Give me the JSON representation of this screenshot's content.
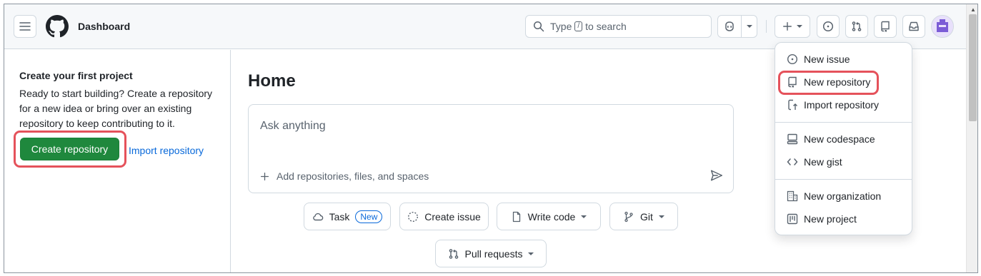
{
  "header": {
    "title": "Dashboard",
    "search_prefix": "Type",
    "search_key": "/",
    "search_suffix": "to search"
  },
  "sidebar": {
    "title": "Create your first project",
    "description": "Ready to start building? Create a repository for a new idea or bring over an existing repository to keep contributing to it.",
    "create_button": "Create repository",
    "import_link": "Import repository"
  },
  "main": {
    "title": "Home",
    "ask_placeholder": "Ask anything",
    "ask_add": "Add repositories, files, and spaces",
    "actions": [
      {
        "label": "Task",
        "badge": "New"
      },
      {
        "label": "Create issue"
      },
      {
        "label": "Write code"
      },
      {
        "label": "Git"
      },
      {
        "label": "Pull requests"
      }
    ]
  },
  "menu": {
    "items": [
      {
        "label": "New issue",
        "icon": "issue-opened-icon"
      },
      {
        "label": "New repository",
        "icon": "repo-icon"
      },
      {
        "label": "Import repository",
        "icon": "repo-push-icon"
      },
      {
        "label": "New codespace",
        "icon": "codespaces-icon"
      },
      {
        "label": "New gist",
        "icon": "code-icon"
      },
      {
        "label": "New organization",
        "icon": "organization-icon"
      },
      {
        "label": "New project",
        "icon": "project-icon"
      }
    ]
  },
  "colors": {
    "primary_button": "#1f883d",
    "link": "#0969da",
    "highlight_ring": "#e5525b"
  }
}
